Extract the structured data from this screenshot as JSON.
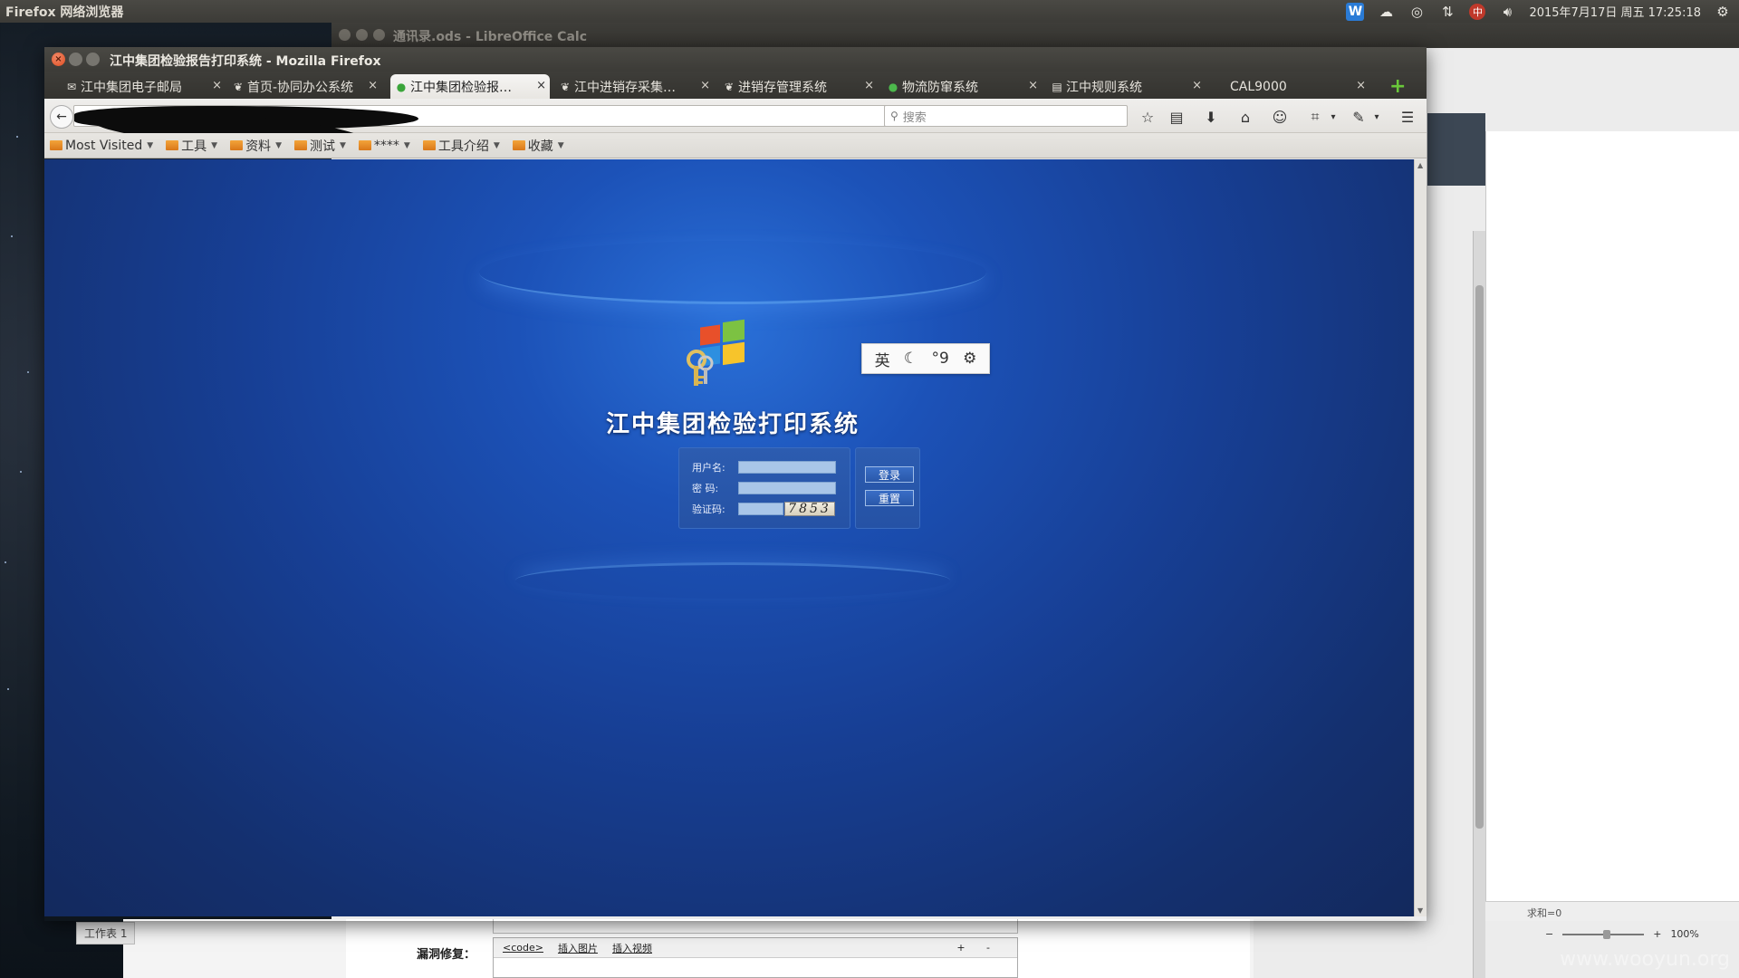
{
  "top_panel": {
    "app_name": "Firefox 网络浏览器",
    "clock": "2015年7月17日 周五 17:25:18",
    "tray_icons": [
      "wps-icon",
      "network-icon",
      "chrome-icon",
      "transfer-arrows-icon",
      "ime-icon",
      "volume-icon",
      "settings-gear-icon"
    ],
    "wps_letter": "W"
  },
  "background_window": {
    "title": "通讯录.ods - LibreOffice Calc",
    "sheet_tab": "工作表 1",
    "formula_status": "求和=0",
    "zoom": "100%",
    "zoom_minus": "−",
    "zoom_plus": "+"
  },
  "web_form": {
    "fix_label": "漏洞修复：",
    "toolbar": [
      "<code>",
      "插入图片",
      "插入视频"
    ],
    "plus_minus": "+ -"
  },
  "watermark": "www.wooyun.org",
  "firefox": {
    "title": "江中集团检验报告打印系统 - Mozilla Firefox",
    "tabs": [
      {
        "label": "江中集团电子邮局",
        "icon": "mail-icon"
      },
      {
        "label": "首页-协同办公系统",
        "icon": "leaf-icon"
      },
      {
        "label": "江中集团检验报…",
        "icon": "globe-icon",
        "active": true
      },
      {
        "label": "江中进销存采集…",
        "icon": "leaf-icon"
      },
      {
        "label": "进销存管理系统",
        "icon": "leaf-icon"
      },
      {
        "label": "物流防窜系统",
        "icon": "globe-icon"
      },
      {
        "label": "江中规则系统",
        "icon": "doc-icon"
      },
      {
        "label": "CAL9000",
        "icon": ""
      }
    ],
    "tab_close": "×",
    "new_tab": "+",
    "search_placeholder": "搜索",
    "bookmarks": [
      {
        "label": "Most Visited"
      },
      {
        "label": "工具"
      },
      {
        "label": "资料"
      },
      {
        "label": "测试"
      },
      {
        "label": "****"
      },
      {
        "label": "工具介绍"
      },
      {
        "label": "收藏"
      }
    ]
  },
  "login_page": {
    "title": "江中集团检验打印系统",
    "username_label": "用户名:",
    "password_label": "密  码:",
    "captcha_label": "验证码:",
    "captcha_value": "7853",
    "login_button": "登录",
    "reset_button": "重置",
    "username_value": "",
    "password_value": "",
    "captcha_input_value": ""
  },
  "ime_toolbar": {
    "mode": "英",
    "moon": "☾",
    "punct": "°9",
    "gear": "⚙"
  }
}
